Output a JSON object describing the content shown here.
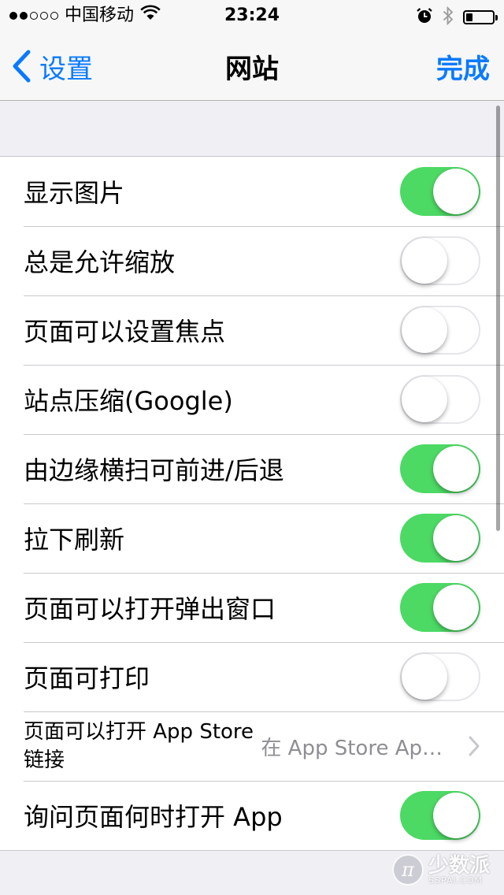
{
  "status_bar": {
    "carrier": "中国移动",
    "time": "23:24",
    "signal_bars_filled": 2,
    "signal_bars_total": 5,
    "battery_level": 0.25,
    "wifi_icon": "wifi-icon",
    "alarm_icon": "alarm-icon",
    "bluetooth_icon": "bluetooth-icon"
  },
  "nav": {
    "back_label": "设置",
    "title": "网站",
    "done_label": "完成"
  },
  "settings": [
    {
      "label": "显示图片",
      "on": true
    },
    {
      "label": "总是允许缩放",
      "on": false
    },
    {
      "label": "页面可以设置焦点",
      "on": false
    },
    {
      "label": "站点压缩(Google)",
      "on": false
    },
    {
      "label": "由边缘横扫可前进/后退",
      "on": true
    },
    {
      "label": "拉下刷新",
      "on": true
    },
    {
      "label": "页面可以打开弹出窗口",
      "on": true
    },
    {
      "label": "页面可打印",
      "on": false
    },
    {
      "label": "页面可以打开 App Store 链接",
      "value": "在 App Store Ap…"
    },
    {
      "label": "询问页面何时打开 App",
      "on": true
    }
  ],
  "colors": {
    "accent": "#0a7aff",
    "toggle_on": "#4cd964",
    "background": "#efeff4"
  },
  "watermark": {
    "cn": "少数派",
    "en": "SSPAI.COM"
  }
}
